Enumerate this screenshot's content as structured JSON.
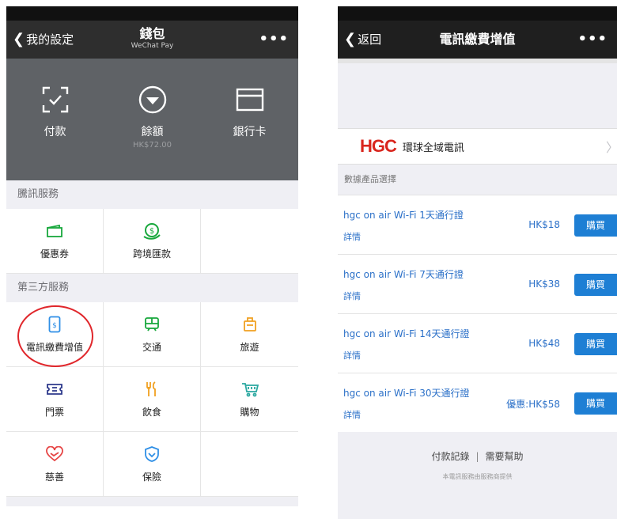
{
  "left": {
    "nav": {
      "back": "我的設定",
      "title": "錢包",
      "subtitle": "WeChat Pay",
      "more": "•••"
    },
    "wallet": [
      {
        "label": "付款",
        "icon": "scan-pay-icon"
      },
      {
        "label": "餘額",
        "sub": "HK$72.00",
        "icon": "balance-icon"
      },
      {
        "label": "銀行卡",
        "icon": "bank-card-icon"
      }
    ],
    "tencent_title": "騰訊服務",
    "tencent_items": [
      {
        "label": "優惠券",
        "icon": "coupon-icon",
        "color": "#18a83c"
      },
      {
        "label": "跨境匯款",
        "icon": "remittance-icon",
        "color": "#18a83c"
      }
    ],
    "third_title": "第三方服務",
    "third_items": [
      {
        "label": "電訊繳費增值",
        "icon": "mobile-topup-icon",
        "color": "#2f8fe6"
      },
      {
        "label": "交通",
        "icon": "transport-icon",
        "color": "#18a83c"
      },
      {
        "label": "旅遊",
        "icon": "travel-icon",
        "color": "#f0a020"
      },
      {
        "label": "門票",
        "icon": "ticket-icon",
        "color": "#2e3a8c"
      },
      {
        "label": "飲食",
        "icon": "food-icon",
        "color": "#f0a020"
      },
      {
        "label": "購物",
        "icon": "shopping-icon",
        "color": "#2aa8a0"
      },
      {
        "label": "慈善",
        "icon": "charity-icon",
        "color": "#e64545"
      },
      {
        "label": "保險",
        "icon": "insurance-icon",
        "color": "#2f8fe6"
      }
    ]
  },
  "right": {
    "nav": {
      "back": "返回",
      "title": "電訊繳費增值",
      "more": "•••"
    },
    "provider": {
      "logo": "HGC",
      "name": "環球全域電訊"
    },
    "section_title": "數據產品選擇",
    "plans": [
      {
        "name": "hgc on air Wi-Fi 1天通行證",
        "detail": "詳情",
        "price": "HK$18",
        "buy": "購買"
      },
      {
        "name": "hgc on air Wi-Fi 7天通行證",
        "detail": "詳情",
        "price": "HK$38",
        "buy": "購買"
      },
      {
        "name": "hgc on air Wi-Fi 14天通行證",
        "detail": "詳情",
        "price": "HK$48",
        "buy": "購買"
      },
      {
        "name": "hgc on air Wi-Fi 30天通行證",
        "detail": "詳情",
        "price": "優惠:HK$58",
        "buy": "購買"
      }
    ],
    "footer": {
      "records": "付款記錄",
      "separator": "|",
      "help": "需要幫助",
      "note": "本電訊服務由服務商提供"
    }
  }
}
